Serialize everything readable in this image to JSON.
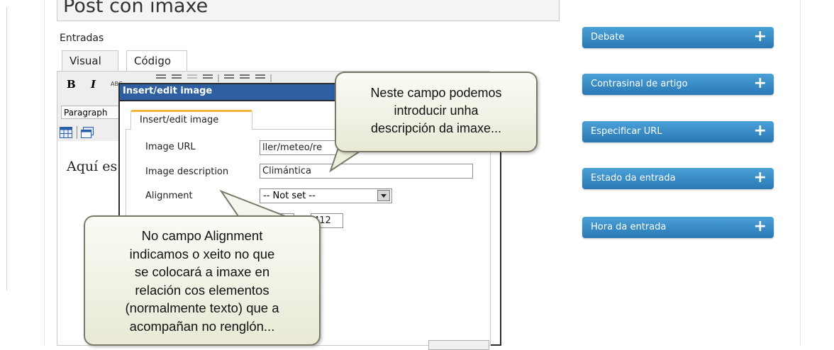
{
  "editor": {
    "post_title": "Post con imaxe",
    "section_label": "Entradas",
    "tabs": [
      "Visual",
      "Código"
    ],
    "toolbar": {
      "bold": "B",
      "italic": "I",
      "strike": "ABC",
      "format_select": "Paragraph"
    },
    "body_text": "Aquí es"
  },
  "dialog": {
    "title": "Insert/edit image",
    "tab": "Insert/edit image",
    "image_url_label": "Image URL",
    "image_url_value": "ller/meteo/re",
    "image_description_label": "Image description",
    "image_description_value": "Climántica",
    "alignment_label": "Alignment",
    "alignment_value": "-- Not set --",
    "dimension_value": "412"
  },
  "callouts": {
    "top": [
      "Neste campo podemos",
      "introducir unha",
      "descripción da imaxe..."
    ],
    "bottom": [
      "No campo Alignment",
      "indicamos o xeito no que",
      "se colocará a imaxe en",
      "relación cos elementos",
      "(normalmente texto) que a",
      "acompañan no renglón..."
    ]
  },
  "sidebar": {
    "boxes": [
      {
        "title": "Debate",
        "action": "+"
      },
      {
        "title": "Contrasinal de artigo",
        "action": "+"
      },
      {
        "title": "Especificar URL",
        "action": "+"
      },
      {
        "title": "Estado da entrada",
        "action": "+"
      },
      {
        "title": "Hora da entrada",
        "action": "+"
      }
    ]
  },
  "colors": {
    "sidebar_box": "#2a78b5",
    "dialog_titlebar": "#2e5fa0",
    "active_tab_accent": "#f0b43b",
    "callout_fill": "#f4f4e8"
  }
}
